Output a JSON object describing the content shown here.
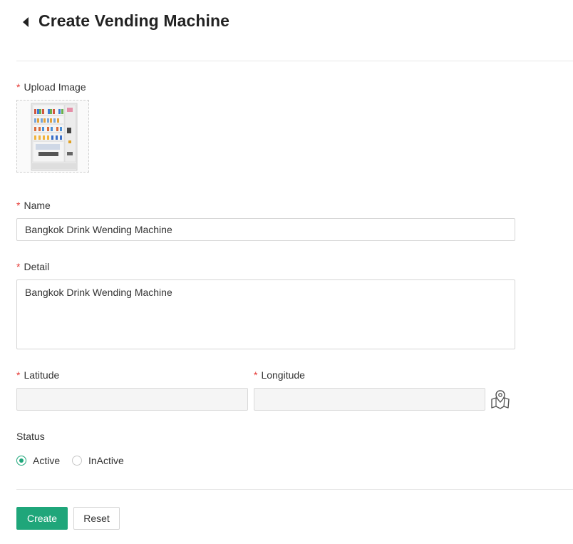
{
  "header": {
    "title": "Create Vending Machine",
    "back_icon": "caret-left-icon"
  },
  "form": {
    "required_mark": "*",
    "upload": {
      "label": "Upload Image",
      "image_icon": "vending-machine-image"
    },
    "name": {
      "label": "Name",
      "value": "Bangkok Drink Wending Machine"
    },
    "detail": {
      "label": "Detail",
      "value": "Bangkok Drink Wending Machine"
    },
    "latitude": {
      "label": "Latitude",
      "value": ""
    },
    "longitude": {
      "label": "Longitude",
      "value": ""
    },
    "map_icon": "map-pin-icon",
    "status": {
      "label": "Status",
      "options": [
        {
          "label": "Active",
          "checked": true
        },
        {
          "label": "InActive",
          "checked": false
        }
      ]
    }
  },
  "actions": {
    "create_label": "Create",
    "reset_label": "Reset"
  },
  "colors": {
    "primary": "#1fa67a",
    "required": "#e53935"
  }
}
